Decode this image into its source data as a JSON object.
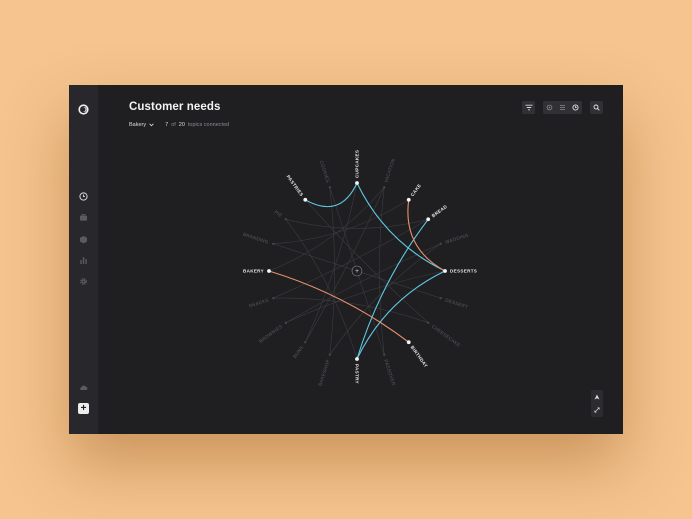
{
  "header": {
    "title": "Customer needs",
    "dropdown_label": "Bakery",
    "connected_count": "7",
    "connected_of": "of",
    "connected_total": "20",
    "connected_suffix": "topics connected"
  },
  "sidebar": {
    "items": [
      {
        "icon": "clock-icon"
      },
      {
        "icon": "briefcase-icon"
      },
      {
        "icon": "cube-icon"
      },
      {
        "icon": "bar-chart-icon"
      },
      {
        "icon": "gear-icon"
      },
      {
        "icon": "cloud-icon"
      }
    ],
    "add_label": "+"
  },
  "toolbar": {
    "icons": [
      "filter-icon",
      "cluster-view-icon",
      "list-view-icon",
      "history-icon",
      "search-icon"
    ]
  },
  "graph": {
    "center_label": "+",
    "topics": [
      {
        "label": "CUPCAKES",
        "active": true
      },
      {
        "label": "VACATION",
        "active": false
      },
      {
        "label": "CAKE",
        "active": true
      },
      {
        "label": "BREAD",
        "active": true
      },
      {
        "label": "WEDDING",
        "active": false
      },
      {
        "label": "DESSERTS",
        "active": true
      },
      {
        "label": "DESSERT",
        "active": false
      },
      {
        "label": "CHEESECAKE",
        "active": false
      },
      {
        "label": "BIRTHDAY",
        "active": true
      },
      {
        "label": "PASSOVER",
        "active": false
      },
      {
        "label": "PASTRY",
        "active": true
      },
      {
        "label": "BAKESHOP",
        "active": false
      },
      {
        "label": "BUNS",
        "active": false
      },
      {
        "label": "BROWNIES",
        "active": false
      },
      {
        "label": "SNACKS",
        "active": false
      },
      {
        "label": "BAKERY",
        "active": true
      },
      {
        "label": "BRANDING",
        "active": false
      },
      {
        "label": "PIE",
        "active": false
      },
      {
        "label": "PASTRIES",
        "active": true
      },
      {
        "label": "COOKIES",
        "active": false
      }
    ],
    "colors": {
      "blue": "#5fc9e4",
      "orange": "#e78f6e",
      "faint": "#3c3c41",
      "label_active": "#e8e8e8",
      "label_inactive": "#5b5b61"
    }
  },
  "zoom": {
    "up_icon": "navigate-up-icon",
    "expand_icon": "expand-icon"
  }
}
